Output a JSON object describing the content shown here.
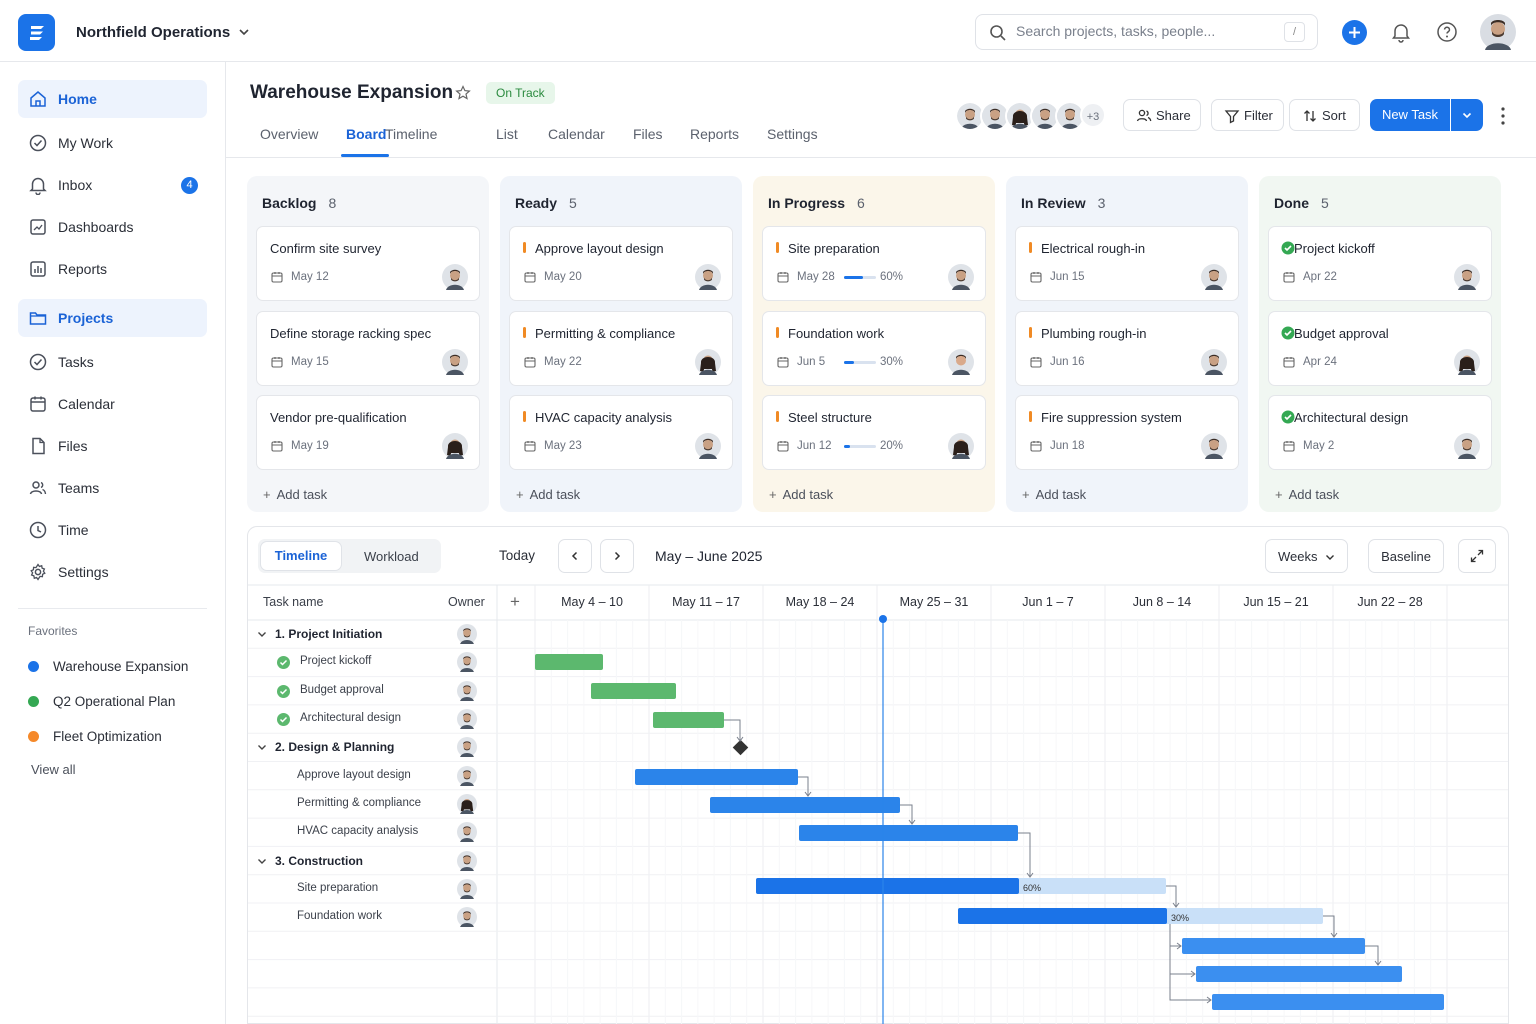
{
  "topbar": {
    "org_name": "Northfield Operations",
    "search_placeholder": "Search projects, tasks, people...",
    "search_shortcut": "/"
  },
  "sidebar": {
    "nav": [
      {
        "label": "Home",
        "icon": "home-icon",
        "active": false,
        "highlight": true
      },
      {
        "label": "My Work",
        "icon": "check-circle-icon"
      },
      {
        "label": "Inbox",
        "icon": "bell-icon",
        "badge": "4"
      },
      {
        "label": "Dashboards",
        "icon": "dashboard-icon"
      },
      {
        "label": "Reports",
        "icon": "bar-chart-icon"
      },
      {
        "label": "Projects",
        "icon": "folder-icon",
        "active": true
      },
      {
        "label": "Tasks",
        "icon": "check-circle-icon"
      },
      {
        "label": "Calendar",
        "icon": "calendar-icon"
      },
      {
        "label": "Files",
        "icon": "file-icon"
      },
      {
        "label": "Teams",
        "icon": "users-icon"
      },
      {
        "label": "Time",
        "icon": "clock-icon"
      },
      {
        "label": "Settings",
        "icon": "gear-icon"
      }
    ],
    "favorites_heading": "Favorites",
    "favorites": [
      {
        "label": "Warehouse Expansion",
        "color": "#1b73e8"
      },
      {
        "label": "Q2 Operational Plan",
        "color": "#34a853"
      },
      {
        "label": "Fleet Optimization",
        "color": "#f5892a"
      }
    ],
    "view_all": "View all"
  },
  "project": {
    "title": "Warehouse Expansion",
    "status": "On Track",
    "tabs": [
      "Overview",
      "Board",
      "Timeline",
      "List",
      "Calendar",
      "Files",
      "Reports",
      "Settings"
    ],
    "active_tab": "Board",
    "members_more": "+3",
    "share": "Share",
    "filter": "Filter",
    "sort": "Sort",
    "new_task": "New Task"
  },
  "board": {
    "add_task": "Add task",
    "columns": [
      {
        "name": "Backlog",
        "count": "8",
        "bg": "#f4f6f9",
        "kind": "plain",
        "cards": [
          {
            "title": "Confirm site survey",
            "date": "May 12",
            "avatar": "m"
          },
          {
            "title": "Define storage racking spec",
            "date": "May 15",
            "avatar": "m"
          },
          {
            "title": "Vendor pre-qualification",
            "date": "May 19",
            "avatar": "f"
          }
        ]
      },
      {
        "name": "Ready",
        "count": "5",
        "bg": "#f0f4fa",
        "kind": "bar",
        "cards": [
          {
            "title": "Approve layout design",
            "date": "May 20",
            "avatar": "m"
          },
          {
            "title": "Permitting & compliance",
            "date": "May 22",
            "avatar": "f"
          },
          {
            "title": "HVAC capacity analysis",
            "date": "May 23",
            "avatar": "m"
          }
        ]
      },
      {
        "name": "In Progress",
        "count": "6",
        "bg": "#fbf6ea",
        "kind": "bar",
        "cards": [
          {
            "title": "Site preparation",
            "date": "May 28",
            "progress": 60,
            "progress_label": "60%",
            "avatar": "m"
          },
          {
            "title": "Foundation work",
            "date": "Jun 5",
            "progress": 30,
            "progress_label": "30%",
            "avatar": "m2"
          },
          {
            "title": "Steel structure",
            "date": "Jun 12",
            "progress": 20,
            "progress_label": "20%",
            "avatar": "f"
          }
        ]
      },
      {
        "name": "In Review",
        "count": "3",
        "bg": "#f0f4fa",
        "kind": "bar",
        "cards": [
          {
            "title": "Electrical rough-in",
            "date": "Jun 15",
            "avatar": "m"
          },
          {
            "title": "Plumbing rough-in",
            "date": "Jun 16",
            "avatar": "m"
          },
          {
            "title": "Fire suppression system",
            "date": "Jun 18",
            "avatar": "m"
          }
        ]
      },
      {
        "name": "Done",
        "count": "5",
        "bg": "#f1f7f2",
        "kind": "check",
        "cards": [
          {
            "title": "Project kickoff",
            "date": "Apr 22",
            "avatar": "m"
          },
          {
            "title": "Budget approval",
            "date": "Apr 24",
            "avatar": "f"
          },
          {
            "title": "Architectural design",
            "date": "May 2",
            "avatar": "m"
          }
        ]
      }
    ]
  },
  "timeline": {
    "view_tabs": [
      "Timeline",
      "Workload"
    ],
    "today": "Today",
    "range": "May – June 2025",
    "scale": "Weeks",
    "baseline": "Baseline",
    "col_task": "Task name",
    "col_owner": "Owner",
    "weeks": [
      "May 4 – 10",
      "May 11 – 17",
      "May 18 – 24",
      "May 25 – 31",
      "Jun 1 – 7",
      "Jun 8 – 14",
      "Jun 15 – 21",
      "Jun 22 – 28"
    ],
    "rows": [
      {
        "label": "1. Project Initiation",
        "group": true,
        "avatar": "m"
      },
      {
        "label": "Project kickoff",
        "done": true,
        "avatar": "m"
      },
      {
        "label": "Budget approval",
        "done": true,
        "avatar": "m"
      },
      {
        "label": "Architectural design",
        "done": true,
        "avatar": "m"
      },
      {
        "label": "2. Design & Planning",
        "group": true,
        "avatar": "m"
      },
      {
        "label": "Approve layout design",
        "avatar": "m"
      },
      {
        "label": "Permitting & compliance",
        "avatar": "f"
      },
      {
        "label": "HVAC capacity analysis",
        "avatar": "m"
      },
      {
        "label": "3. Construction",
        "group": true,
        "avatar": "m"
      },
      {
        "label": "Site preparation",
        "avatar": "m"
      },
      {
        "label": "Foundation work",
        "avatar": "m"
      }
    ],
    "bar_labels": [
      "60%",
      "30%"
    ]
  },
  "colors": {
    "primary": "#1b73e8",
    "done": "#5cb86e",
    "warn": "#f08a24",
    "bar_light": "#c9e0f8"
  }
}
